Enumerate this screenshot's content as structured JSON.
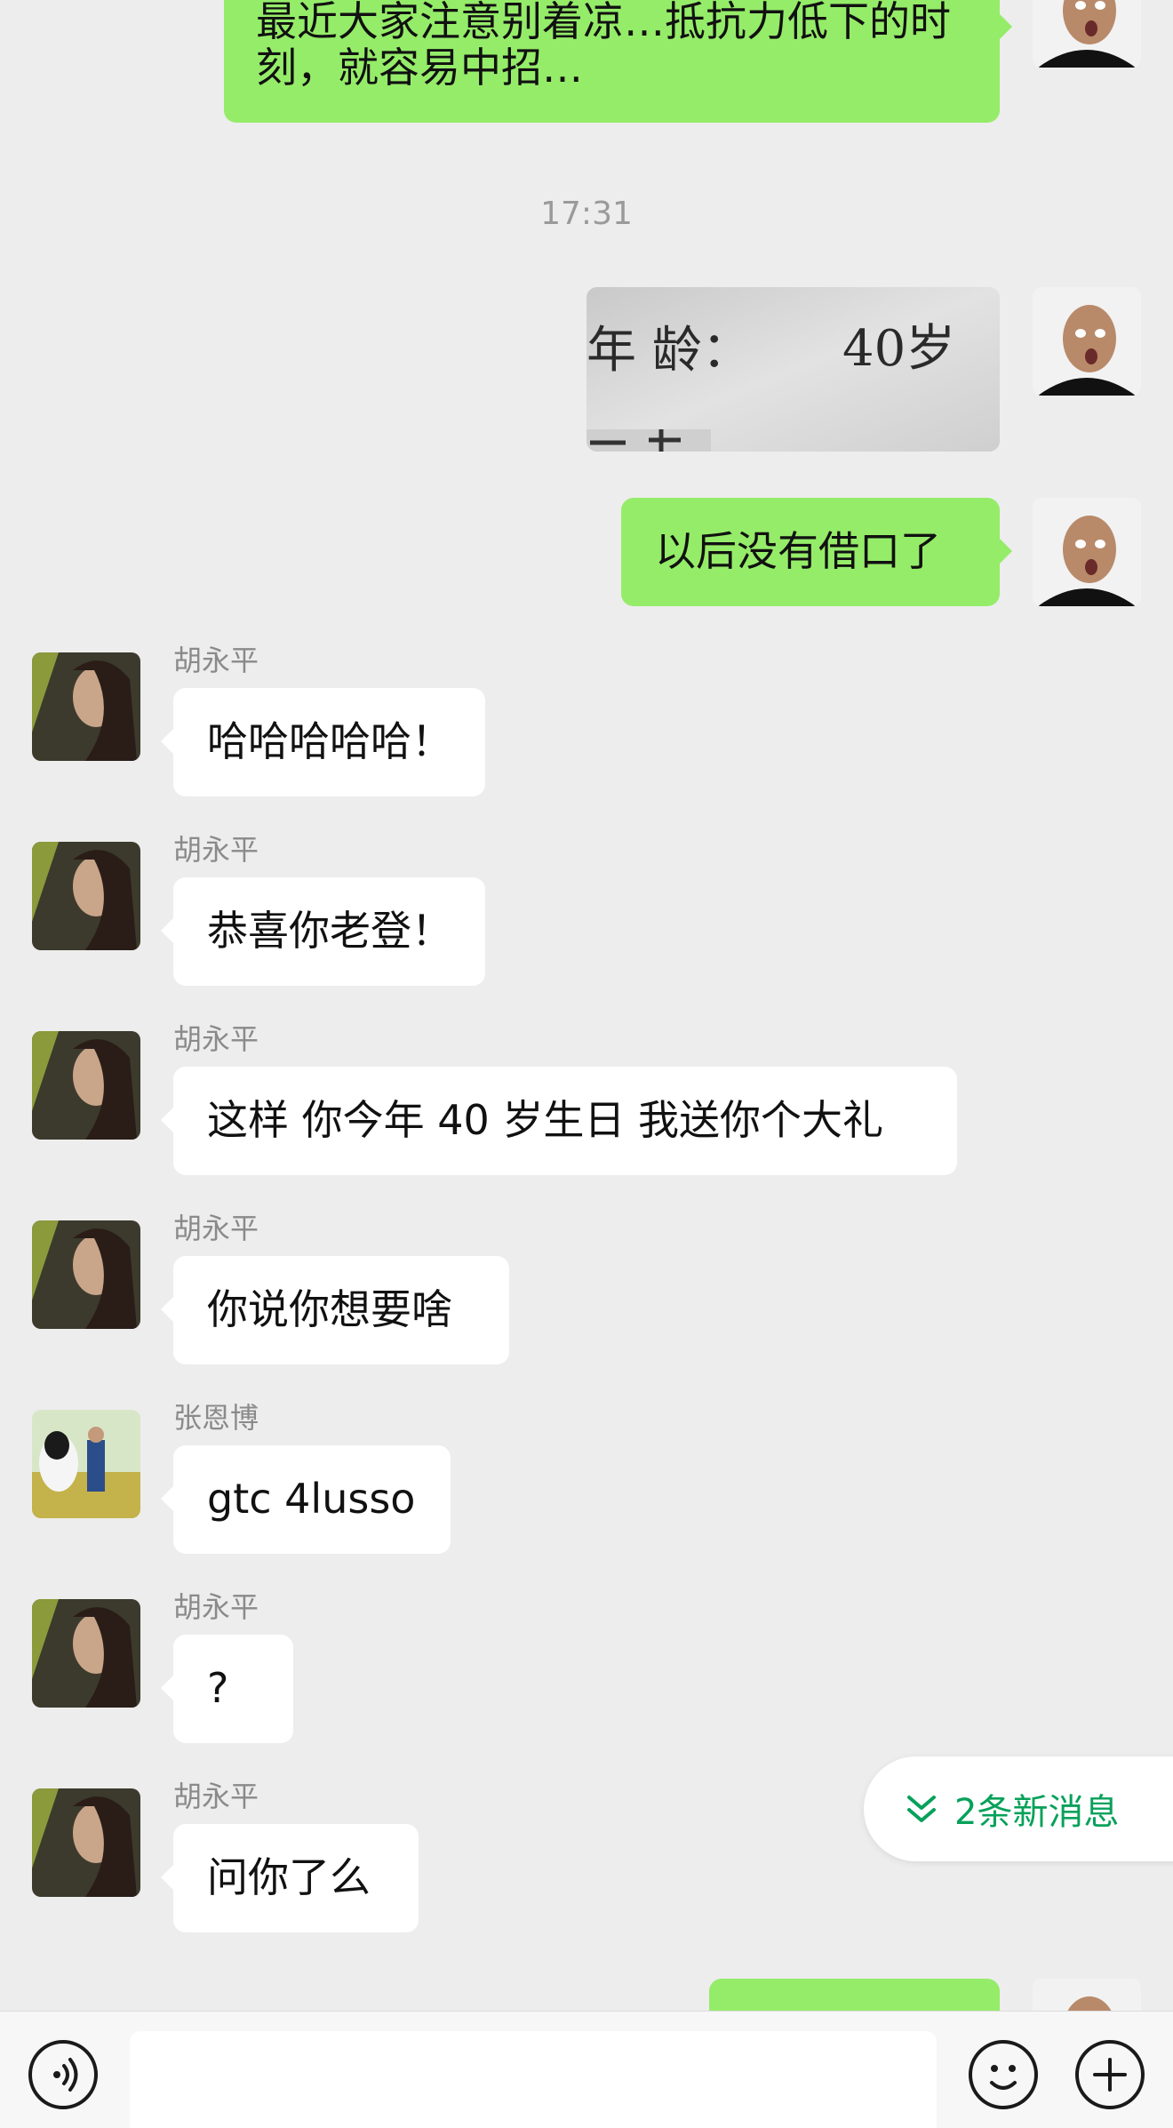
{
  "chat": {
    "top_message": "最近大家注意别着凉…抵抗力低下的时刻，就容易中招…",
    "timestamp": "17:31",
    "photo_text": {
      "label": "年  龄：",
      "value": "40岁"
    },
    "my_message_1": "以后没有借口了",
    "messages": [
      {
        "sender": "胡永平",
        "text": "哈哈哈哈哈！"
      },
      {
        "sender": "胡永平",
        "text": "恭喜你老登！"
      },
      {
        "sender": "胡永平",
        "text": "这样 你今年 40 岁生日 我送你个大礼"
      },
      {
        "sender": "胡永平",
        "text": "你说你想要啥"
      },
      {
        "sender": "张恩博",
        "text": "gtc 4lusso"
      },
      {
        "sender": "胡永平",
        "text": "?"
      },
      {
        "sender": "胡永平",
        "text": "问你了么"
      }
    ],
    "new_messages_label": "2条新消息"
  },
  "colors": {
    "sent_bubble": "#95ec69",
    "received_bubble": "#ffffff",
    "accent": "#07a15a",
    "background": "#ededed"
  },
  "icons": {
    "voice": "voice-icon",
    "emoji": "emoji-icon",
    "plus": "plus-icon",
    "double_chevron": "double-chevron-down-icon"
  }
}
